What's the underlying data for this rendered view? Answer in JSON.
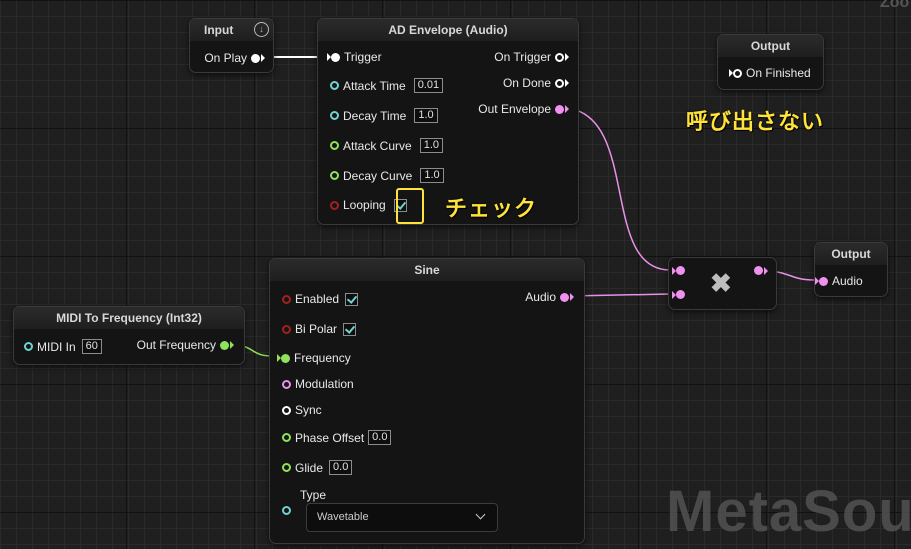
{
  "zoom_label": "Zoo",
  "watermark": "MetaSour",
  "input_node": {
    "title": "Input",
    "on_play": "On Play"
  },
  "ad_envelope": {
    "title": "AD Envelope (Audio)",
    "trigger": "Trigger",
    "attack_time": {
      "label": "Attack Time",
      "value": "0.01"
    },
    "decay_time": {
      "label": "Decay Time",
      "value": "1.0"
    },
    "attack_curve": {
      "label": "Attack Curve",
      "value": "1.0"
    },
    "decay_curve": {
      "label": "Decay Curve",
      "value": "1.0"
    },
    "looping": {
      "label": "Looping",
      "checked": true
    },
    "on_trigger": "On Trigger",
    "on_done": "On Done",
    "out_envelope": "Out Envelope"
  },
  "output_finished": {
    "title": "Output",
    "pin": "On Finished"
  },
  "annotation_no_call": "呼び出さない",
  "annotation_check": "チェック",
  "sine": {
    "title": "Sine",
    "enabled": "Enabled",
    "bi_polar": "Bi Polar",
    "frequency": "Frequency",
    "modulation": "Modulation",
    "sync": "Sync",
    "phase_offset": {
      "label": "Phase Offset",
      "value": "0.0"
    },
    "glide": {
      "label": "Glide",
      "value": "0.0"
    },
    "type": {
      "label": "Type",
      "value": "Wavetable"
    },
    "audio_out": "Audio"
  },
  "midi_to_freq": {
    "title": "MIDI To Frequency (Int32)",
    "midi_in": {
      "label": "MIDI In",
      "value": "60"
    },
    "out_frequency": "Out Frequency"
  },
  "multiply_node": {
    "symbol": "✖"
  },
  "output_audio": {
    "title": "Output",
    "pin": "Audio"
  },
  "colors": {
    "trigger": "#ffffff",
    "audio": "#f090f0",
    "float": "#8ee35a",
    "int": "#6fd3d3",
    "bool": "#a32020",
    "annotation": "#ffe23a"
  }
}
